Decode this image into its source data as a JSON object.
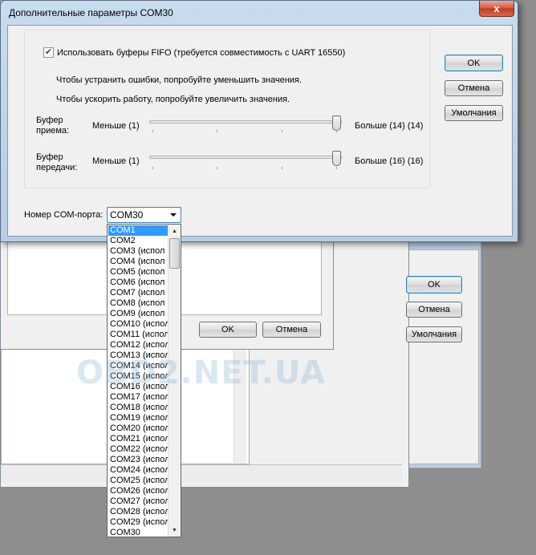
{
  "dialog": {
    "title": "Дополнительные параметры COM30",
    "close_symbol": "x",
    "fifo_checkbox_label": "Использовать буферы FIFO (требуется совместимость с UART 16550)",
    "fifo_checked": true,
    "hint_errors": "Чтобы устранить ошибки, попробуйте уменьшить значения.",
    "hint_speed": "Чтобы ускорить работу, попробуйте увеличить значения.",
    "receive": {
      "label_line1": "Буфер",
      "label_line2": "приема:",
      "min_label": "Меньше (1)",
      "max_label": "Больше (14) (14)",
      "value": 14
    },
    "transmit": {
      "label_line1": "Буфер",
      "label_line2": "передачи:",
      "min_label": "Меньше (1)",
      "max_label": "Больше (16) (16)",
      "value": 16
    },
    "port_label": "Номер COM-порта:",
    "port_value": "COM30",
    "ok_label": "OK",
    "cancel_label": "Отмена",
    "defaults_label": "Умолчания"
  },
  "dropdown": {
    "items": [
      "COM1",
      "COM2",
      "COM3 (испол",
      "COM4 (испол",
      "COM5 (испол",
      "COM6 (испол",
      "COM7 (испол",
      "COM8 (испол",
      "COM9 (испол",
      "COM10 (испол",
      "COM11 (испол",
      "COM12 (испол",
      "COM13 (испол",
      "COM14 (испол",
      "COM15 (испол",
      "COM16 (испол",
      "COM17 (испол",
      "COM18 (испол",
      "COM19 (испол",
      "COM20 (испол",
      "COM21 (испол",
      "COM22 (испол",
      "COM23 (испол",
      "COM24 (испол",
      "COM25 (испол",
      "COM26 (испол",
      "COM27 (испол",
      "COM28 (испол",
      "COM29 (испол",
      "COM30"
    ],
    "selected_index": 0
  },
  "background_window_1": {
    "ok_label": "OK",
    "cancel_label": "Отмена"
  },
  "background_window_2": {
    "ok_label": "OK",
    "cancel_label": "Отмена",
    "defaults_label": "Умолчания"
  },
  "watermark": "OBD2.NET.UA",
  "colors": {
    "selection": "#3399ff",
    "title_bar": "#c9dcef",
    "close_button": "#c23b1f",
    "desktop": "#8e8e8e"
  }
}
